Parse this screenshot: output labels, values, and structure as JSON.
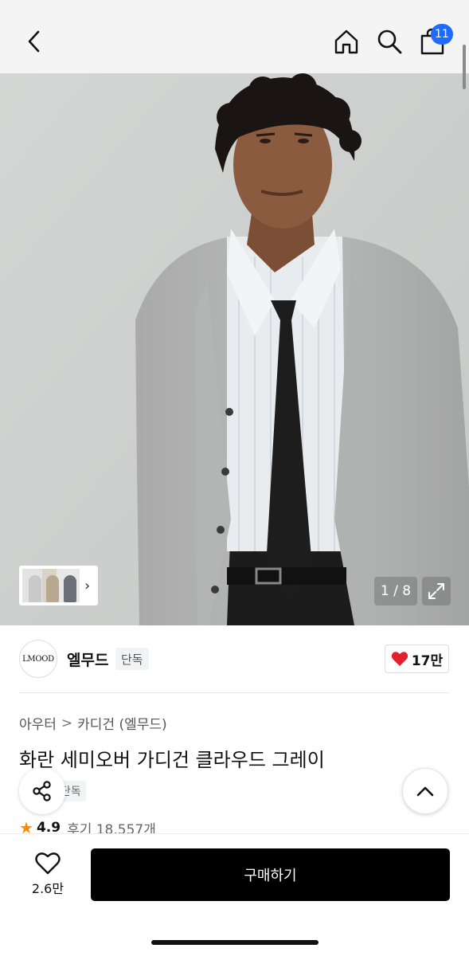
{
  "header": {
    "back_icon": "chevron-left-icon",
    "home_icon": "home-icon",
    "search_icon": "search-icon",
    "bag_icon": "shopping-bag-icon",
    "cart_badge": "11",
    "badge_color": "#1f6bff"
  },
  "gallery": {
    "counter": "1 / 8",
    "expand_icon": "expand-icon",
    "thumb_arrow": "›"
  },
  "brand": {
    "logo_text": "LMOOD",
    "name": "엘무드",
    "exclusive_badge": "단독",
    "like_count": "17만",
    "like_color": "#e4202c"
  },
  "product": {
    "breadcrumb": [
      "아우터",
      "카디건 (엘무드)"
    ],
    "breadcrumb_sep": ">",
    "title": "화란 세미오버 가디건 클라우드 그레이",
    "tag": "단독",
    "rating": "4.9",
    "reviews": "후기 18,557개"
  },
  "bottom": {
    "wish_count": "2.6만",
    "buy_label": "구매하기"
  }
}
